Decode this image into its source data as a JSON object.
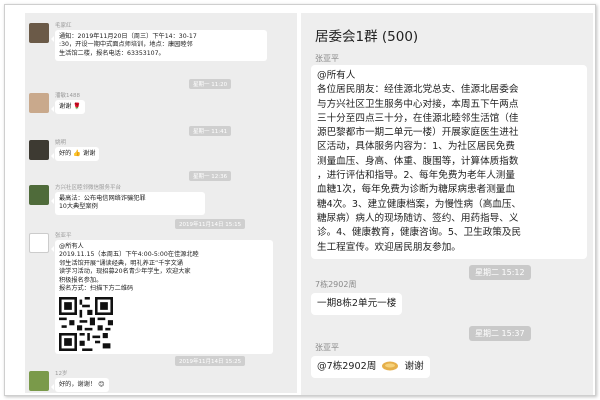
{
  "left_chat": {
    "messages": [
      {
        "sender": "毛家红",
        "lines": [
          "通知：2019年11月20日（周三）下午14：30-17",
          ":30，开设一期中式面点师培训，地点：康园睦邻",
          "生活馆二楼，报名电话：63353107。"
        ]
      },
      {
        "timestamp": "星期一 11:20"
      },
      {
        "sender": "潘敏1488",
        "lines": [
          "谢谢 🌹"
        ]
      },
      {
        "timestamp": "星期一 11:41"
      },
      {
        "sender": "姚明",
        "lines": [
          "好的 👍 谢谢"
        ]
      },
      {
        "timestamp": "星期一 12:36"
      },
      {
        "sender": "方兴社区睦邻微信服务平台",
        "lines": [
          "最高法：公布电信网络诈骗犯罪",
          "10大典型案例"
        ]
      },
      {
        "timestamp": "2019年11月14日 15:15"
      },
      {
        "sender": "张亚平",
        "lines": [
          "@所有人",
          "2019.11.15（本周五）下午4:00-5:00在佳源北睦",
          "邻生活馆开展“诵读经典，明礼养正”千字文诵",
          "读学习活动，现招募20名青少年学生，欢迎大家",
          "积极报名参加。",
          "报名方式：扫描下方二维码"
        ]
      },
      {
        "timestamp": "2019年11月14日 15:25"
      },
      {
        "sender": "12岁",
        "lines": [
          "好的，谢谢！ 😊"
        ]
      }
    ]
  },
  "right_chat": {
    "title": "居委会1群 (500)",
    "sender1": "张亚平",
    "notice_lines": [
      "@所有人",
      "各位居民朋友：经佳源北党总支、佳源北居委会",
      "与方兴社区卫生服务中心对接，本周五下午两点",
      "三十分至四点三十分，在佳源北睦邻生活馆（佳",
      "源巴黎都市一期二单元一楼）开展家庭医生进社",
      "区活动，具体服务内容为：1、为社区居民免费",
      "测量血压、身高、体重、腹围等，计算体质指数",
      "，进行评估和指导。2、每年免费为老年人测量",
      "血糖1次，每年免费为诊断为糖尿病患者测量血",
      "糖4次。3、建立健康档案，为慢性病（高血压、",
      "糖尿病）病人的现场随访、签约、用药指导、义",
      "诊。4、健康教育，健康咨询。5、卫生政策及民",
      "生工程宣传。欢迎居民朋友参加。"
    ],
    "ts1": "星期二 15:12",
    "sender2": "7栋2902周",
    "reply2": "一期8栋2单元一楼",
    "ts2": "星期二 15:37",
    "sender3": "张亚平",
    "reply3_mention": "@7栋2902周",
    "reply3_text": "谢谢"
  },
  "colors": {
    "chat_bg": "#eeeeee",
    "bubble": "#ffffff",
    "timestamp_bg": "#c9c9c9"
  }
}
